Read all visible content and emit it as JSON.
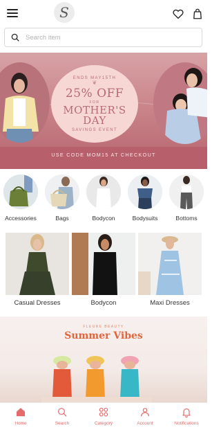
{
  "header": {
    "logo_letter": "S",
    "icons": [
      "menu-icon",
      "heart-icon",
      "shopping-bag-icon"
    ]
  },
  "search": {
    "placeholder": "Search item"
  },
  "hero_banner": {
    "ends": "ENDS MAY15TH",
    "discount": "25% OFF",
    "for": "FOR",
    "title_line1": "MOTHER'S",
    "title_line2": "DAY",
    "subtitle": "SAVINGS EVENT",
    "promo": "USE CODE MOM15 AT CHECKOUT"
  },
  "categories": [
    {
      "label": "Accessories"
    },
    {
      "label": "Bags"
    },
    {
      "label": "Bodycon"
    },
    {
      "label": "Bodysuits"
    },
    {
      "label": "Bottoms"
    }
  ],
  "featured": [
    {
      "label": "Casual Dresses"
    },
    {
      "label": "Bodycon"
    },
    {
      "label": "Maxi Dresses"
    }
  ],
  "summer_banner": {
    "brand": "FLEURE BEAUTY",
    "title": "Summer Vibes"
  },
  "tabbar": {
    "items": [
      {
        "label": "Home",
        "icon": "home-icon"
      },
      {
        "label": "Search",
        "icon": "search-icon"
      },
      {
        "label": "Category",
        "icon": "category-icon"
      },
      {
        "label": "Account",
        "icon": "account-icon"
      },
      {
        "label": "Notifications",
        "icon": "bell-icon"
      }
    ]
  },
  "colors": {
    "accent": "#e56a6a",
    "hero_bg": "#b85f6c",
    "oval_bg": "#f7d7d3",
    "summer_title": "#e2643a"
  }
}
